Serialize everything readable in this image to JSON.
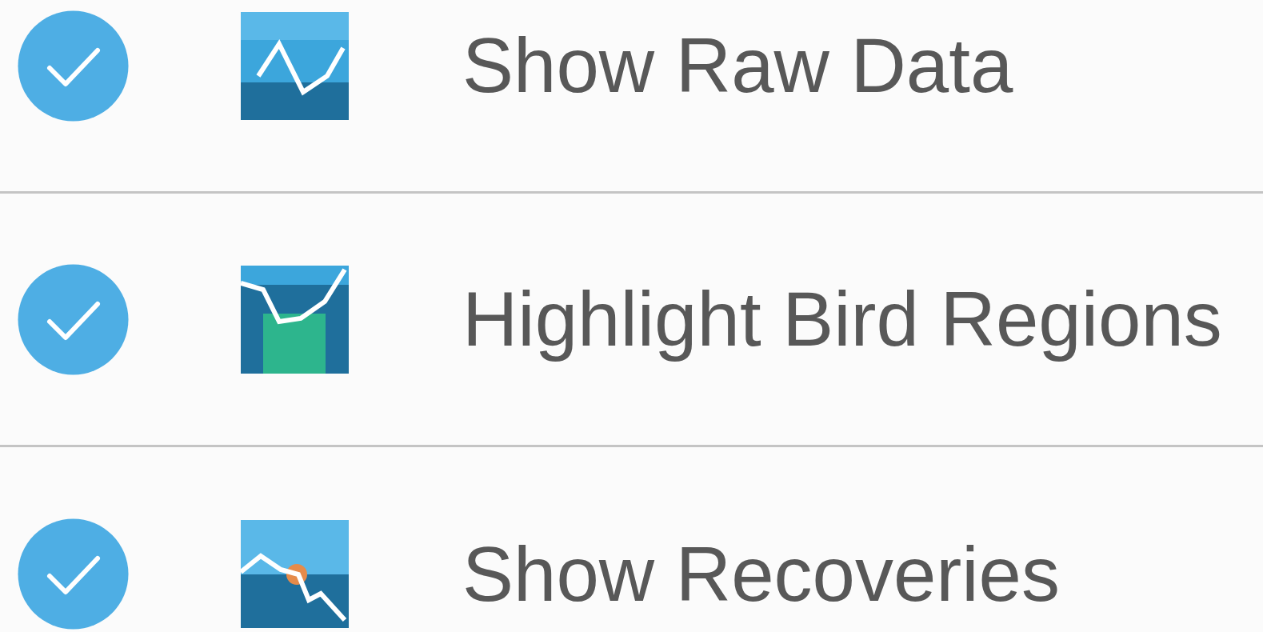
{
  "options": [
    {
      "kind": "raw",
      "label": "Show Raw Data",
      "checked": true
    },
    {
      "kind": "regions",
      "label": "Highlight Bird Regions",
      "checked": true
    },
    {
      "kind": "recoveries",
      "label": "Show Recoveries",
      "checked": true
    }
  ]
}
